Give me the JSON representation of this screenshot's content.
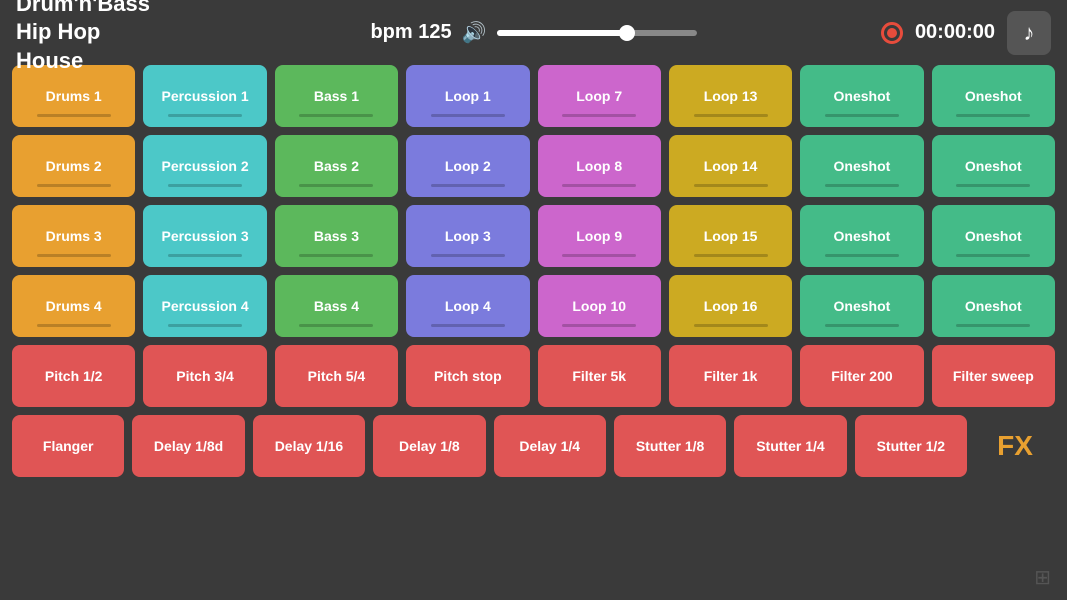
{
  "header": {
    "genres": [
      {
        "label": "Drum'n'Bass",
        "active": false
      },
      {
        "label": "Hip Hop",
        "active": false
      },
      {
        "label": "House",
        "active": true
      }
    ],
    "bpm_label": "bpm 125",
    "timer": "00:00:00",
    "music_icon": "♪"
  },
  "rows": [
    [
      {
        "label": "Drums 1",
        "type": "drum",
        "line": true
      },
      {
        "label": "Percussion 1",
        "type": "percussion",
        "line": true
      },
      {
        "label": "Bass 1",
        "type": "bass",
        "line": true
      },
      {
        "label": "Loop 1",
        "type": "loop-blue",
        "line": true
      },
      {
        "label": "Loop 7",
        "type": "loop-purple",
        "line": true
      },
      {
        "label": "Loop 13",
        "type": "loop-yellow",
        "line": true
      },
      {
        "label": "Oneshot",
        "type": "oneshot",
        "line": true
      },
      {
        "label": "Oneshot",
        "type": "oneshot",
        "line": true
      }
    ],
    [
      {
        "label": "Drums 2",
        "type": "drum",
        "line": true
      },
      {
        "label": "Percussion 2",
        "type": "percussion",
        "line": true
      },
      {
        "label": "Bass 2",
        "type": "bass",
        "line": true
      },
      {
        "label": "Loop 2",
        "type": "loop-blue",
        "line": true
      },
      {
        "label": "Loop 8",
        "type": "loop-purple",
        "line": true
      },
      {
        "label": "Loop 14",
        "type": "loop-yellow",
        "line": true
      },
      {
        "label": "Oneshot",
        "type": "oneshot",
        "line": true
      },
      {
        "label": "Oneshot",
        "type": "oneshot",
        "line": true
      }
    ],
    [
      {
        "label": "Drums 3",
        "type": "drum",
        "line": true
      },
      {
        "label": "Percussion 3",
        "type": "percussion",
        "line": true
      },
      {
        "label": "Bass 3",
        "type": "bass",
        "line": true
      },
      {
        "label": "Loop 3",
        "type": "loop-blue",
        "line": true
      },
      {
        "label": "Loop 9",
        "type": "loop-purple",
        "line": true
      },
      {
        "label": "Loop 15",
        "type": "loop-yellow",
        "line": true
      },
      {
        "label": "Oneshot",
        "type": "oneshot",
        "line": true
      },
      {
        "label": "Oneshot",
        "type": "oneshot",
        "line": true
      }
    ],
    [
      {
        "label": "Drums 4",
        "type": "drum",
        "line": true
      },
      {
        "label": "Percussion 4",
        "type": "percussion",
        "line": true
      },
      {
        "label": "Bass 4",
        "type": "bass",
        "line": true
      },
      {
        "label": "Loop 4",
        "type": "loop-blue",
        "line": true
      },
      {
        "label": "Loop 10",
        "type": "loop-purple",
        "line": true
      },
      {
        "label": "Loop 16",
        "type": "loop-yellow",
        "line": true
      },
      {
        "label": "Oneshot",
        "type": "oneshot",
        "line": true
      },
      {
        "label": "Oneshot",
        "type": "oneshot",
        "line": true
      }
    ],
    [
      {
        "label": "Pitch 1/2",
        "type": "fx-red"
      },
      {
        "label": "Pitch 3/4",
        "type": "fx-red"
      },
      {
        "label": "Pitch 5/4",
        "type": "fx-red"
      },
      {
        "label": "Pitch stop",
        "type": "fx-red"
      },
      {
        "label": "Filter 5k",
        "type": "fx-red"
      },
      {
        "label": "Filter 1k",
        "type": "fx-red"
      },
      {
        "label": "Filter 200",
        "type": "fx-red"
      },
      {
        "label": "Filter sweep",
        "type": "fx-red"
      }
    ],
    [
      {
        "label": "Flanger",
        "type": "fx-red"
      },
      {
        "label": "Delay 1/8d",
        "type": "fx-red"
      },
      {
        "label": "Delay 1/16",
        "type": "fx-red"
      },
      {
        "label": "Delay 1/8",
        "type": "fx-red"
      },
      {
        "label": "Delay 1/4",
        "type": "fx-red"
      },
      {
        "label": "Stutter 1/8",
        "type": "fx-red"
      },
      {
        "label": "Stutter 1/4",
        "type": "fx-red"
      },
      {
        "label": "Stutter 1/2",
        "type": "fx-red"
      }
    ]
  ],
  "fx_label": "FX",
  "bottom_icon": "⊞"
}
